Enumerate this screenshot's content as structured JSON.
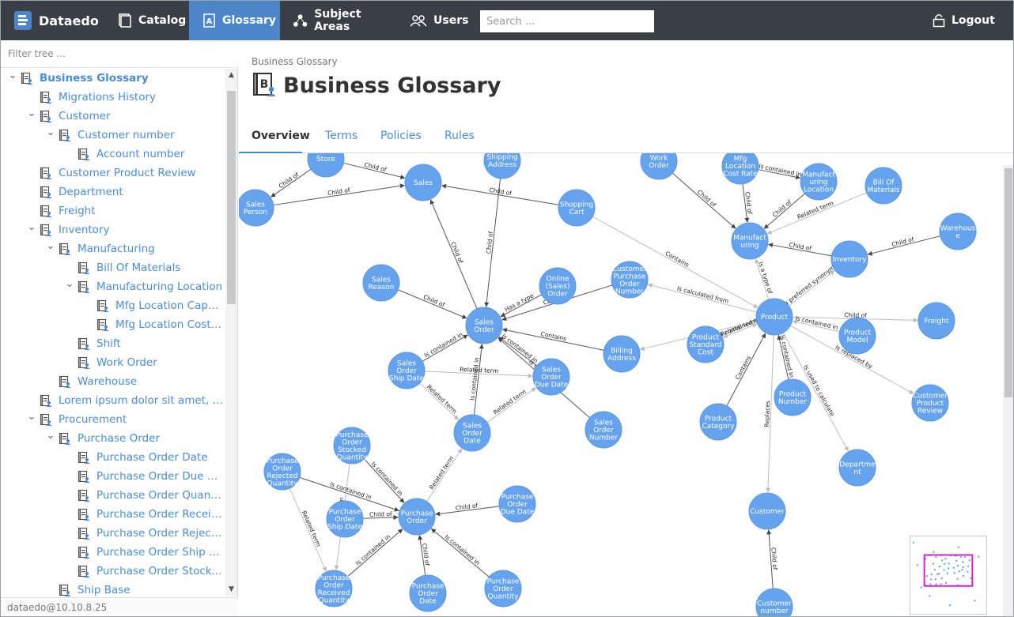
{
  "app": {
    "name": "Dataedo"
  },
  "nav": {
    "catalog": "Catalog",
    "glossary": "Glossary",
    "subject_areas": "Subject Areas",
    "users": "Users",
    "search_placeholder": "Search ...",
    "logout": "Logout"
  },
  "sidebar": {
    "filter_placeholder": "Filter tree ...",
    "footer": "dataedo@10.10.8.25",
    "items": [
      {
        "label": "Business Glossary",
        "level": 0,
        "toggle": "collapse",
        "root": true
      },
      {
        "label": "Migrations History",
        "level": 1,
        "toggle": ""
      },
      {
        "label": "Customer",
        "level": 1,
        "toggle": "collapse"
      },
      {
        "label": "Customer number",
        "level": 2,
        "toggle": "collapse"
      },
      {
        "label": "Account number",
        "level": 3,
        "toggle": ""
      },
      {
        "label": "Customer Product Review",
        "level": 1,
        "toggle": ""
      },
      {
        "label": "Department",
        "level": 1,
        "toggle": ""
      },
      {
        "label": "Freight",
        "level": 1,
        "toggle": ""
      },
      {
        "label": "Inventory",
        "level": 1,
        "toggle": "collapse"
      },
      {
        "label": "Manufacturing",
        "level": 2,
        "toggle": "collapse"
      },
      {
        "label": "Bill Of Materials",
        "level": 3,
        "toggle": ""
      },
      {
        "label": "Manufacturing Location",
        "level": 3,
        "toggle": "collapse"
      },
      {
        "label": "Mfg Location Capaci...",
        "level": 4,
        "toggle": ""
      },
      {
        "label": "Mfg Location Cost R...",
        "level": 4,
        "toggle": ""
      },
      {
        "label": "Shift",
        "level": 3,
        "toggle": ""
      },
      {
        "label": "Work Order",
        "level": 3,
        "toggle": ""
      },
      {
        "label": "Warehouse",
        "level": 2,
        "toggle": ""
      },
      {
        "label": "Lorem ipsum dolor sit amet, co...",
        "level": 1,
        "toggle": ""
      },
      {
        "label": "Procurement",
        "level": 1,
        "toggle": "collapse"
      },
      {
        "label": "Purchase Order",
        "level": 2,
        "toggle": "collapse"
      },
      {
        "label": "Purchase Order Date",
        "level": 3,
        "toggle": ""
      },
      {
        "label": "Purchase Order Due Date",
        "level": 3,
        "toggle": ""
      },
      {
        "label": "Purchase Order Quantity",
        "level": 3,
        "toggle": ""
      },
      {
        "label": "Purchase Order Receive...",
        "level": 3,
        "toggle": ""
      },
      {
        "label": "Purchase Order Rejecte...",
        "level": 3,
        "toggle": ""
      },
      {
        "label": "Purchase Order Ship Da...",
        "level": 3,
        "toggle": ""
      },
      {
        "label": "Purchase Order Stocked...",
        "level": 3,
        "toggle": ""
      },
      {
        "label": "Ship Base",
        "level": 2,
        "toggle": ""
      }
    ]
  },
  "main": {
    "breadcrumb": "Business Glossary",
    "title": "Business Glossary",
    "tabs": [
      "Overview",
      "Terms",
      "Policies",
      "Rules"
    ],
    "active_tab": "Overview"
  },
  "graph": {
    "nodes": [
      {
        "id": "store",
        "lines": [
          "Store"
        ]
      },
      {
        "id": "sales",
        "lines": [
          "Sales"
        ]
      },
      {
        "id": "shipaddr",
        "lines": [
          "Shipping",
          "Address"
        ]
      },
      {
        "id": "workorder",
        "lines": [
          "Work",
          "Order"
        ]
      },
      {
        "id": "mfgcost",
        "lines": [
          "Mfg",
          "Location",
          "Cost Rate"
        ]
      },
      {
        "id": "mfgloc",
        "lines": [
          "Manufact",
          "uring",
          "Location"
        ]
      },
      {
        "id": "bom",
        "lines": [
          "Bill Of",
          "Materials"
        ]
      },
      {
        "id": "salesperson",
        "lines": [
          "Sales",
          "Person"
        ]
      },
      {
        "id": "cart",
        "lines": [
          "Shopping",
          "Cart"
        ]
      },
      {
        "id": "warehouse",
        "lines": [
          "Warehous",
          "e"
        ]
      },
      {
        "id": "manufacturing",
        "lines": [
          "Manufact",
          "uring"
        ]
      },
      {
        "id": "inventory",
        "lines": [
          "Inventory"
        ]
      },
      {
        "id": "salesreason",
        "lines": [
          "Sales",
          "Reason"
        ]
      },
      {
        "id": "onlineorder",
        "lines": [
          "Online",
          "(Sales)",
          "Order"
        ]
      },
      {
        "id": "custpo",
        "lines": [
          "Customer",
          "Purchase",
          "Order",
          "Number"
        ]
      },
      {
        "id": "product",
        "lines": [
          "Product"
        ]
      },
      {
        "id": "salesorder",
        "lines": [
          "Sales",
          "Order"
        ]
      },
      {
        "id": "freight",
        "lines": [
          "Freight"
        ]
      },
      {
        "id": "productmodel",
        "lines": [
          "Product",
          "Model"
        ]
      },
      {
        "id": "stdcost",
        "lines": [
          "Product",
          "Standard",
          "Cost"
        ]
      },
      {
        "id": "billaddr",
        "lines": [
          "Billing",
          "Address"
        ]
      },
      {
        "id": "soshipdate",
        "lines": [
          "Sales",
          "Order",
          "Ship Date"
        ]
      },
      {
        "id": "soduedate",
        "lines": [
          "Sales",
          "Order",
          "Due Date"
        ]
      },
      {
        "id": "custreview",
        "lines": [
          "Customer",
          "Product",
          "Review"
        ]
      },
      {
        "id": "prodnumber",
        "lines": [
          "Product",
          "Number"
        ]
      },
      {
        "id": "prodcategory",
        "lines": [
          "Product",
          "Category"
        ]
      },
      {
        "id": "sonumber",
        "lines": [
          "Sales",
          "Order",
          "Number"
        ]
      },
      {
        "id": "sodate",
        "lines": [
          "Sales",
          "Order",
          "Date"
        ]
      },
      {
        "id": "department",
        "lines": [
          "Departme",
          "nt"
        ]
      },
      {
        "id": "postocked",
        "lines": [
          "Purchase",
          "Order",
          "Stocked",
          "Quantity"
        ]
      },
      {
        "id": "porejected",
        "lines": [
          "Purchase",
          "Order",
          "Rejected",
          "Quantity"
        ]
      },
      {
        "id": "poduedate",
        "lines": [
          "Purchase",
          "Order",
          "Due Date"
        ]
      },
      {
        "id": "poshipdate",
        "lines": [
          "Purchase",
          "Order",
          "Ship Date"
        ]
      },
      {
        "id": "purchaseorder",
        "lines": [
          "Purchase",
          "Order"
        ]
      },
      {
        "id": "customer",
        "lines": [
          "Customer"
        ]
      },
      {
        "id": "poreceived",
        "lines": [
          "Purchase",
          "Order",
          "Received",
          "Quantity"
        ]
      },
      {
        "id": "podate",
        "lines": [
          "Purchase",
          "Order",
          "Date"
        ]
      },
      {
        "id": "poquantity",
        "lines": [
          "Purchase",
          "Order",
          "Quantity"
        ]
      },
      {
        "id": "custnumber",
        "lines": [
          "Customer",
          "number"
        ]
      }
    ],
    "edges": [
      {
        "from": "store",
        "to": "salesperson",
        "label": "Child of"
      },
      {
        "from": "store",
        "to": "sales",
        "label": "Child of"
      },
      {
        "from": "salesperson",
        "to": "sales",
        "label": "Child of"
      },
      {
        "from": "cart",
        "to": "sales",
        "label": "Child of"
      },
      {
        "from": "salesorder",
        "to": "sales",
        "label": "Child of"
      },
      {
        "from": "shipaddr",
        "to": "salesorder",
        "label": "Child of"
      },
      {
        "from": "salesreason",
        "to": "salesorder",
        "label": "Child of"
      },
      {
        "from": "onlineorder",
        "to": "salesorder",
        "label": "Has a type"
      },
      {
        "from": "custpo",
        "to": "salesorder",
        "label": "Contains"
      },
      {
        "from": "billaddr",
        "to": "salesorder",
        "label": "Contains"
      },
      {
        "from": "soshipdate",
        "to": "salesorder",
        "label": "Is contained in"
      },
      {
        "from": "soduedate",
        "to": "salesorder",
        "label": "Is contained in"
      },
      {
        "from": "sonumber",
        "to": "salesorder",
        "label": "Is contained in"
      },
      {
        "from": "sodate",
        "to": "salesorder",
        "label": "Is contained in"
      },
      {
        "from": "soshipdate",
        "to": "soduedate",
        "label": "Related term"
      },
      {
        "from": "soshipdate",
        "to": "sodate",
        "label": "Related term"
      },
      {
        "from": "sodate",
        "to": "soduedate",
        "label": "Related term"
      },
      {
        "from": "product",
        "to": "custpo",
        "label": "Is calculated from"
      },
      {
        "from": "cart",
        "to": "product",
        "label": "Contains"
      },
      {
        "from": "workorder",
        "to": "manufacturing",
        "label": "Child of"
      },
      {
        "from": "mfgcost",
        "to": "manufacturing",
        "label": "Child of"
      },
      {
        "from": "mfgloc",
        "to": "manufacturing",
        "label": "Child of"
      },
      {
        "from": "mfgcost",
        "to": "mfgloc",
        "label": "Is contained in"
      },
      {
        "from": "bom",
        "to": "manufacturing",
        "label": "Related term"
      },
      {
        "from": "warehouse",
        "to": "inventory",
        "label": "Child of"
      },
      {
        "from": "inventory",
        "to": "manufacturing",
        "label": "Child of"
      },
      {
        "from": "product",
        "to": "manufacturing",
        "label": "Is a type of"
      },
      {
        "from": "product",
        "to": "inventory",
        "label": "Is a preferred synonym of"
      },
      {
        "from": "product",
        "to": "freight",
        "label": "Child of"
      },
      {
        "from": "productmodel",
        "to": "product",
        "label": "Is contained in"
      },
      {
        "from": "product",
        "to": "stdcost",
        "label": "Related term"
      },
      {
        "from": "product",
        "to": "billaddr",
        "label": ""
      },
      {
        "from": "stdcost",
        "to": "product",
        "label": "Is contained in"
      },
      {
        "from": "product",
        "to": "custreview",
        "label": "Is replaced by"
      },
      {
        "from": "prodnumber",
        "to": "product",
        "label": "Is contained in"
      },
      {
        "from": "prodcategory",
        "to": "product",
        "label": "Contains"
      },
      {
        "from": "product",
        "to": "department",
        "label": "Is used to calculate"
      },
      {
        "from": "product",
        "to": "customer",
        "label": "Replaces"
      },
      {
        "from": "custnumber",
        "to": "customer",
        "label": "Child of"
      },
      {
        "from": "postocked",
        "to": "purchaseorder",
        "label": "Is contained in"
      },
      {
        "from": "porejected",
        "to": "purchaseorder",
        "label": "Is contained in"
      },
      {
        "from": "poduedate",
        "to": "purchaseorder",
        "label": "Child of"
      },
      {
        "from": "poshipdate",
        "to": "purchaseorder",
        "label": "Child of"
      },
      {
        "from": "poreceived",
        "to": "purchaseorder",
        "label": "Is contained in"
      },
      {
        "from": "podate",
        "to": "purchaseorder",
        "label": "Child of"
      },
      {
        "from": "poquantity",
        "to": "purchaseorder",
        "label": "Is contained in"
      },
      {
        "from": "purchaseorder",
        "to": "sodate",
        "label": "Related term"
      },
      {
        "from": "postocked",
        "to": "poreceived",
        "label": "Related term"
      },
      {
        "from": "porejected",
        "to": "poreceived",
        "label": "Related term"
      }
    ]
  }
}
